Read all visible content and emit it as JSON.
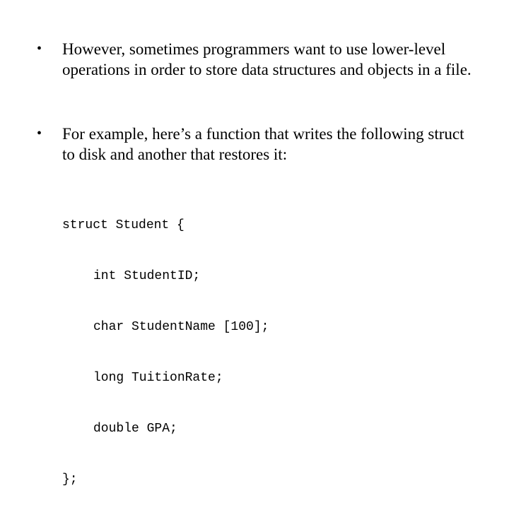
{
  "slide": {
    "bullet_glyph": "•",
    "bullets": [
      {
        "text": "However, sometimes programmers want to use lower-level operations in order to store data structures and objects in a file."
      },
      {
        "text": "For example, here’s a function that writes the following struct to disk and another that restores it:"
      }
    ],
    "code": {
      "lines": [
        "struct Student {",
        "int StudentID;",
        "char StudentName [100];",
        "long TuitionRate;",
        "double GPA;",
        "};"
      ]
    }
  }
}
